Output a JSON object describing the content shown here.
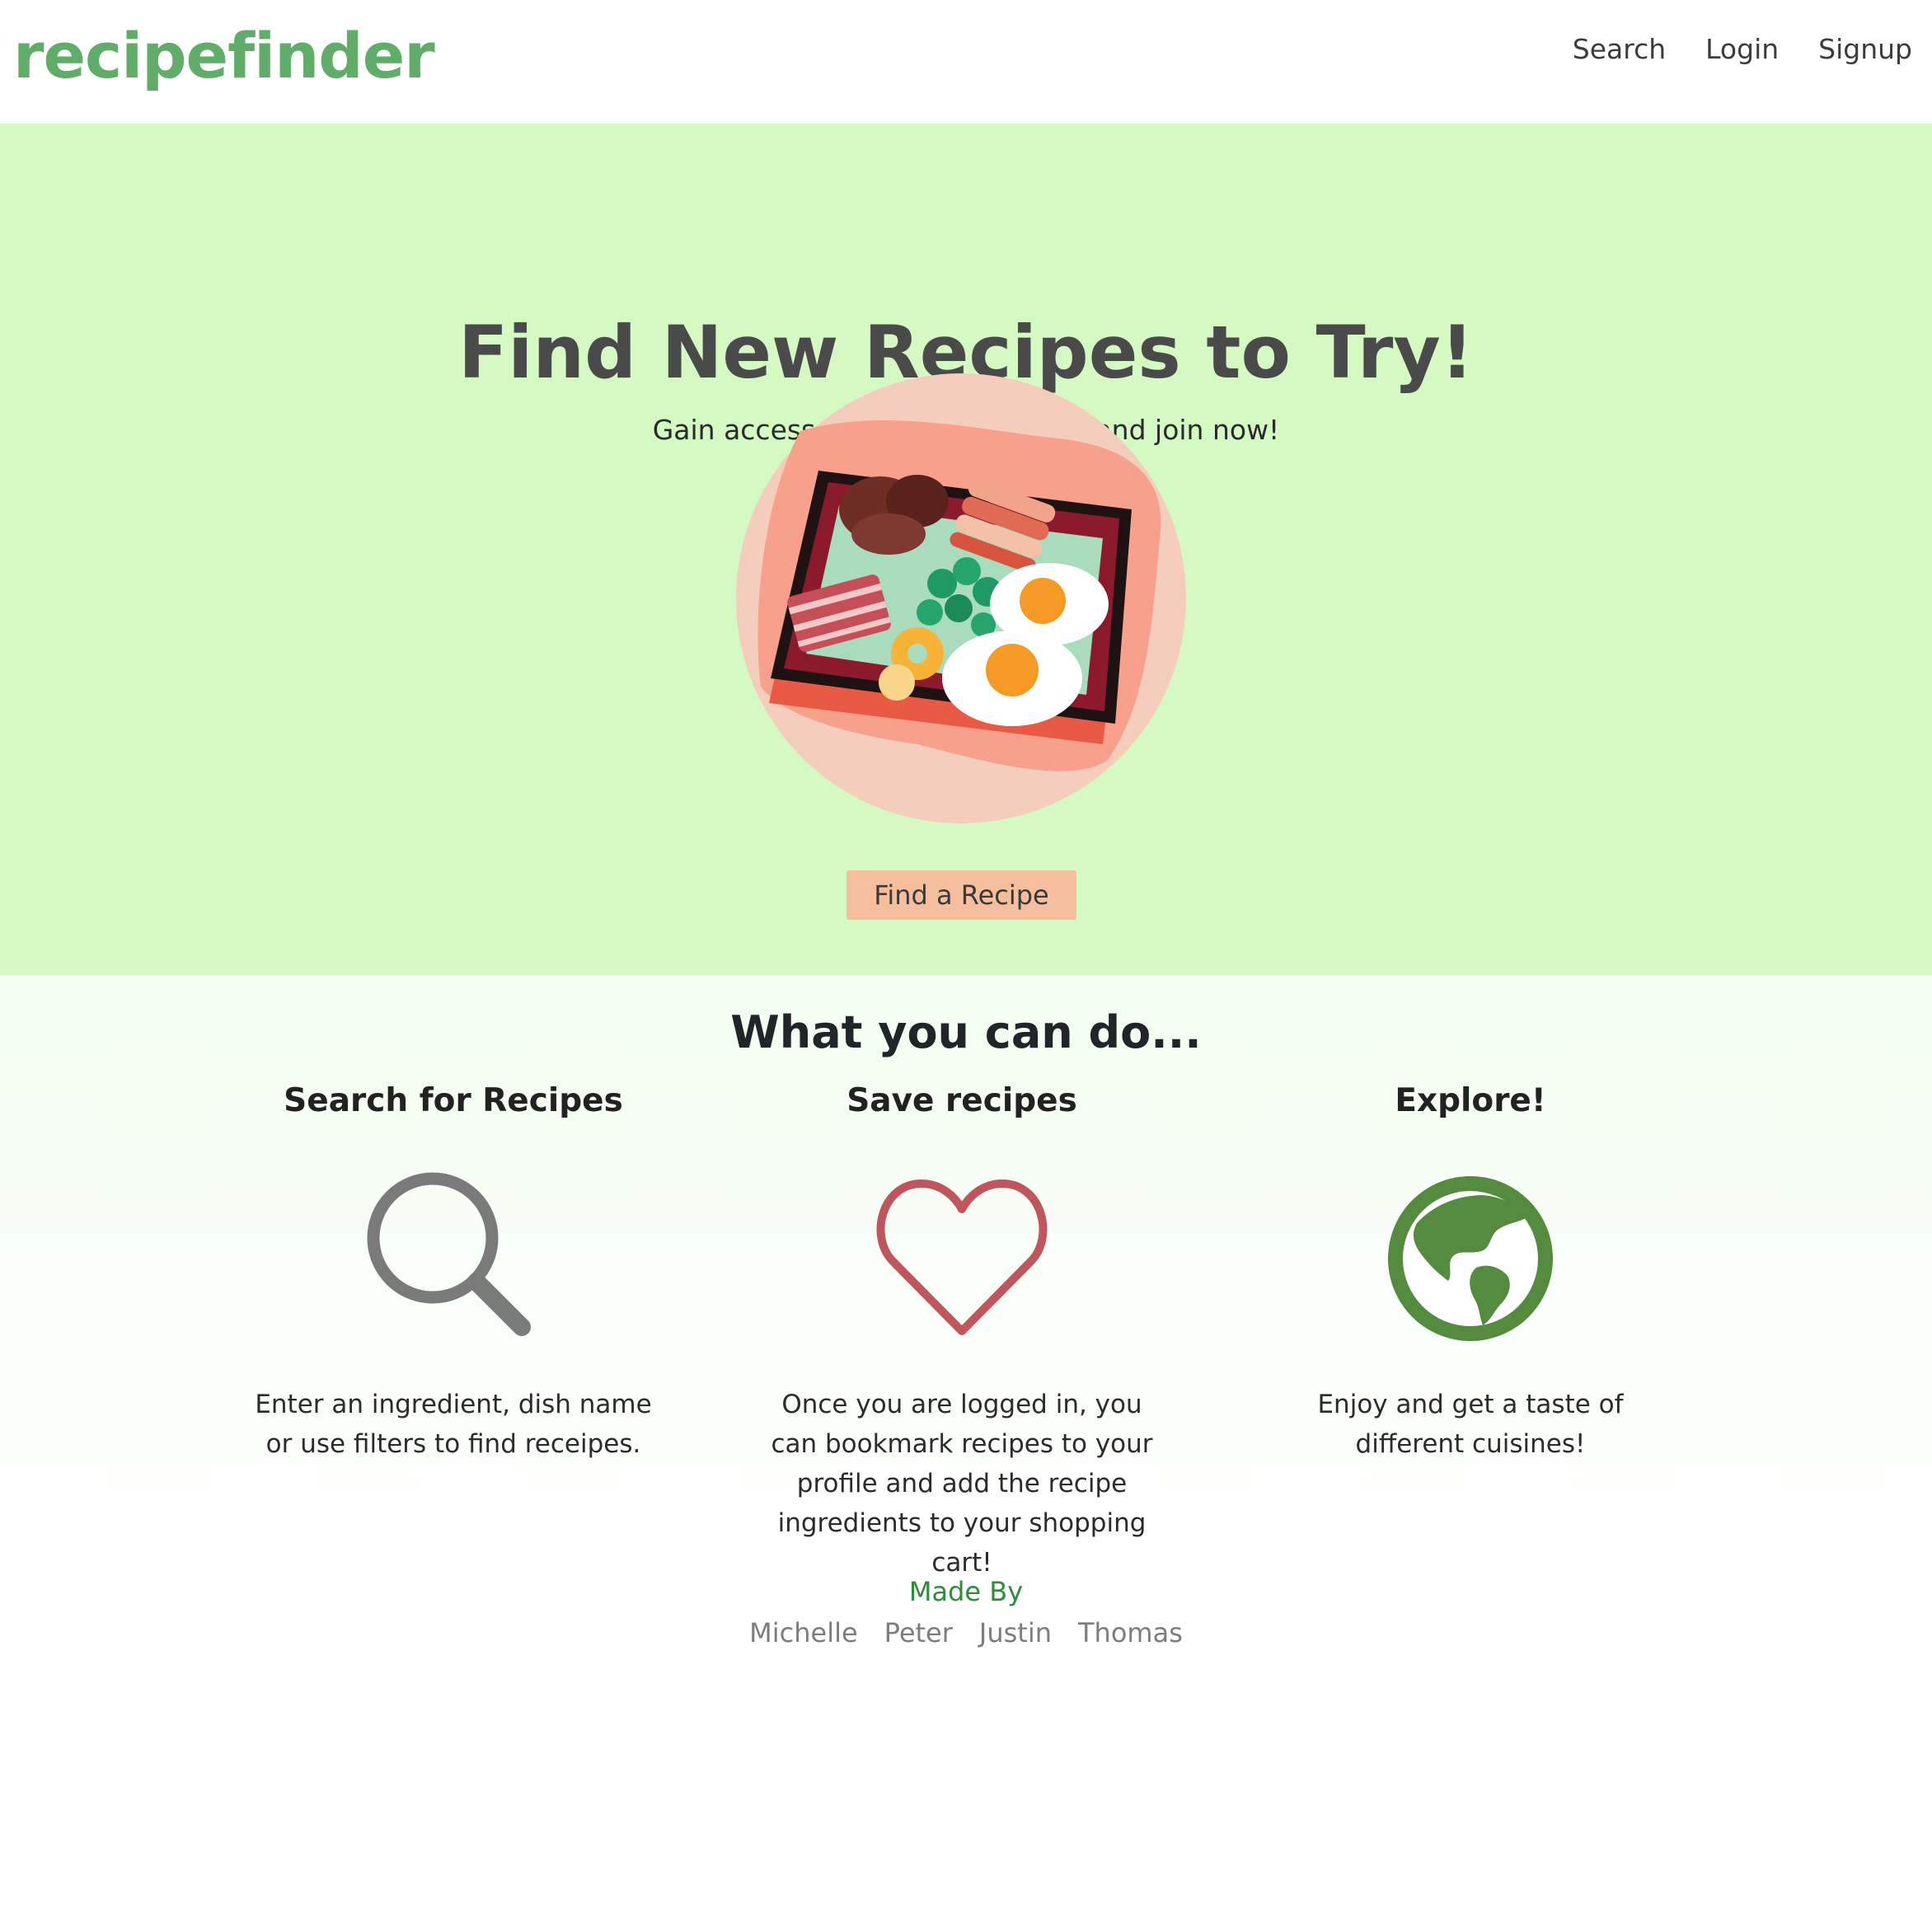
{
  "navbar": {
    "brand": "recipefinder",
    "links": [
      "Search",
      "Login",
      "Signup"
    ]
  },
  "hero": {
    "title": "Find New Recipes to Try!",
    "subtitle": "Gain access to delicious recipes and join now!",
    "button_label": "Find a Recipe"
  },
  "features": {
    "title": "What you can do...",
    "items": [
      {
        "heading": "Search for Recipes",
        "icon": "search-icon",
        "text": "Enter an ingredient, dish name or use filters to find receipes."
      },
      {
        "heading": "Save recipes",
        "icon": "heart-icon",
        "text": "Once you are logged in, you can bookmark recipes to your profile and add the recipe ingredients to your shopping cart!"
      },
      {
        "heading": "Explore!",
        "icon": "globe-icon",
        "text": "Enjoy and get a taste of different cuisines!"
      }
    ]
  },
  "footer": {
    "label": "Made By",
    "names": [
      "Michelle",
      "Peter",
      "Justin",
      "Thomas"
    ]
  },
  "colors": {
    "brand": "#5fad68",
    "hero_background": "#d4f9c2",
    "button": "#f5bf9e",
    "search_icon": "#7a7a7a",
    "heart_icon": "#c0565b",
    "globe_icon": "#558b3e",
    "footer_label": "#2e8b3a"
  }
}
